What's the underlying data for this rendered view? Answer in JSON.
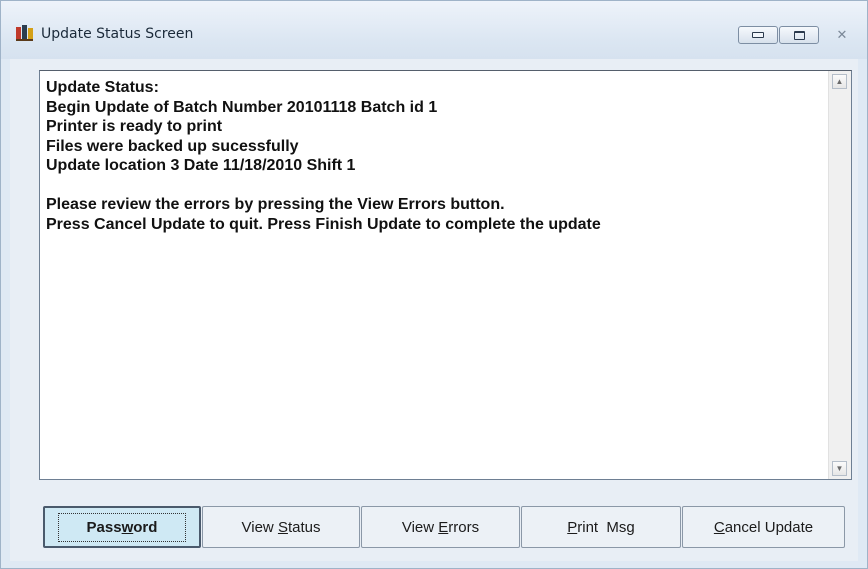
{
  "window": {
    "title": "Update Status Screen",
    "controls": {
      "minimize": "minimize-icon",
      "maximize": "maximize-icon",
      "close": "✕"
    }
  },
  "status": {
    "lines": [
      "Update Status:",
      "Begin Update of Batch Number 20101118 Batch id 1",
      "Printer is ready to print",
      "Files were backed up sucessfully",
      "Update location 3 Date 11/18/2010 Shift 1",
      "",
      "Please review the errors by pressing the View Errors button.",
      "Press Cancel Update to quit.  Press Finish Update to complete the update"
    ]
  },
  "buttons": {
    "password": {
      "pre": "Pass",
      "key": "w",
      "post": "ord"
    },
    "view_status": {
      "pre": "View ",
      "key": "S",
      "post": "tatus"
    },
    "view_errors": {
      "pre": "View ",
      "key": "E",
      "post": "rrors"
    },
    "print_msg": {
      "pre": "",
      "key": "P",
      "post": "rint  Msg"
    },
    "cancel_update": {
      "pre": "",
      "key": "C",
      "post": "ancel Update"
    }
  },
  "colors": {
    "default_button": "#cfe9f4",
    "button": "#ecf1f6",
    "titlebar": "#dbe6f2"
  }
}
